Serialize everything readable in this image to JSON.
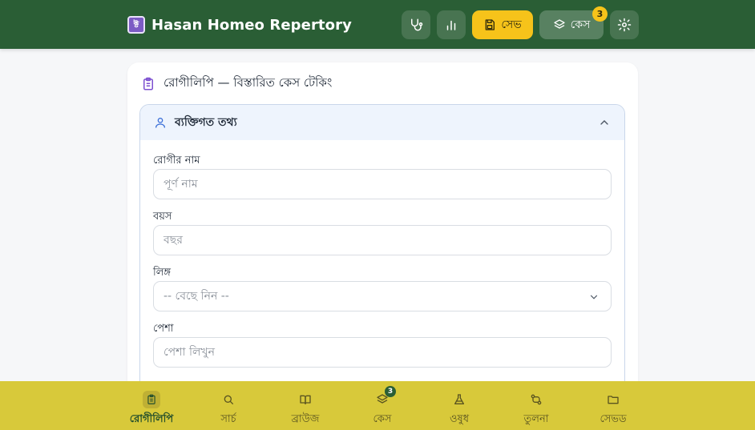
{
  "header": {
    "app_title": "Hasan Homeo Repertory",
    "logo_glyph": "ক্ট",
    "save_label": "সেভ",
    "case_label": "কেস",
    "case_count": "3"
  },
  "card": {
    "title": "রোগীলিপি — বিস্তারিত কেস টেকিং",
    "section": {
      "title": "ব্যক্তিগত তথ্য",
      "fields": [
        {
          "label": "রোগীর নাম",
          "placeholder": "পূর্ণ নাম"
        },
        {
          "label": "বয়স",
          "placeholder": "বছর"
        },
        {
          "label": "লিঙ্গ",
          "value": "-- বেছে নিন --"
        },
        {
          "label": "পেশা",
          "placeholder": "পেশা লিখুন"
        }
      ]
    }
  },
  "bottom_nav": {
    "items": [
      {
        "label": "রোগীলিপি",
        "icon": "clipboard-icon",
        "active": true
      },
      {
        "label": "সার্চ",
        "icon": "search-icon"
      },
      {
        "label": "ব্রাউজ",
        "icon": "book-icon"
      },
      {
        "label": "কেস",
        "icon": "layers-icon",
        "badge": "3"
      },
      {
        "label": "ওষুধ",
        "icon": "flask-icon"
      },
      {
        "label": "তুলনা",
        "icon": "compare-icon"
      },
      {
        "label": "সেভড",
        "icon": "folder-icon"
      }
    ]
  },
  "colors": {
    "header_bg": "#2a5e35",
    "accent_yellow": "#f6c31a",
    "nav_bg": "#d8c93a",
    "section_head_bg": "#eef4fd"
  }
}
